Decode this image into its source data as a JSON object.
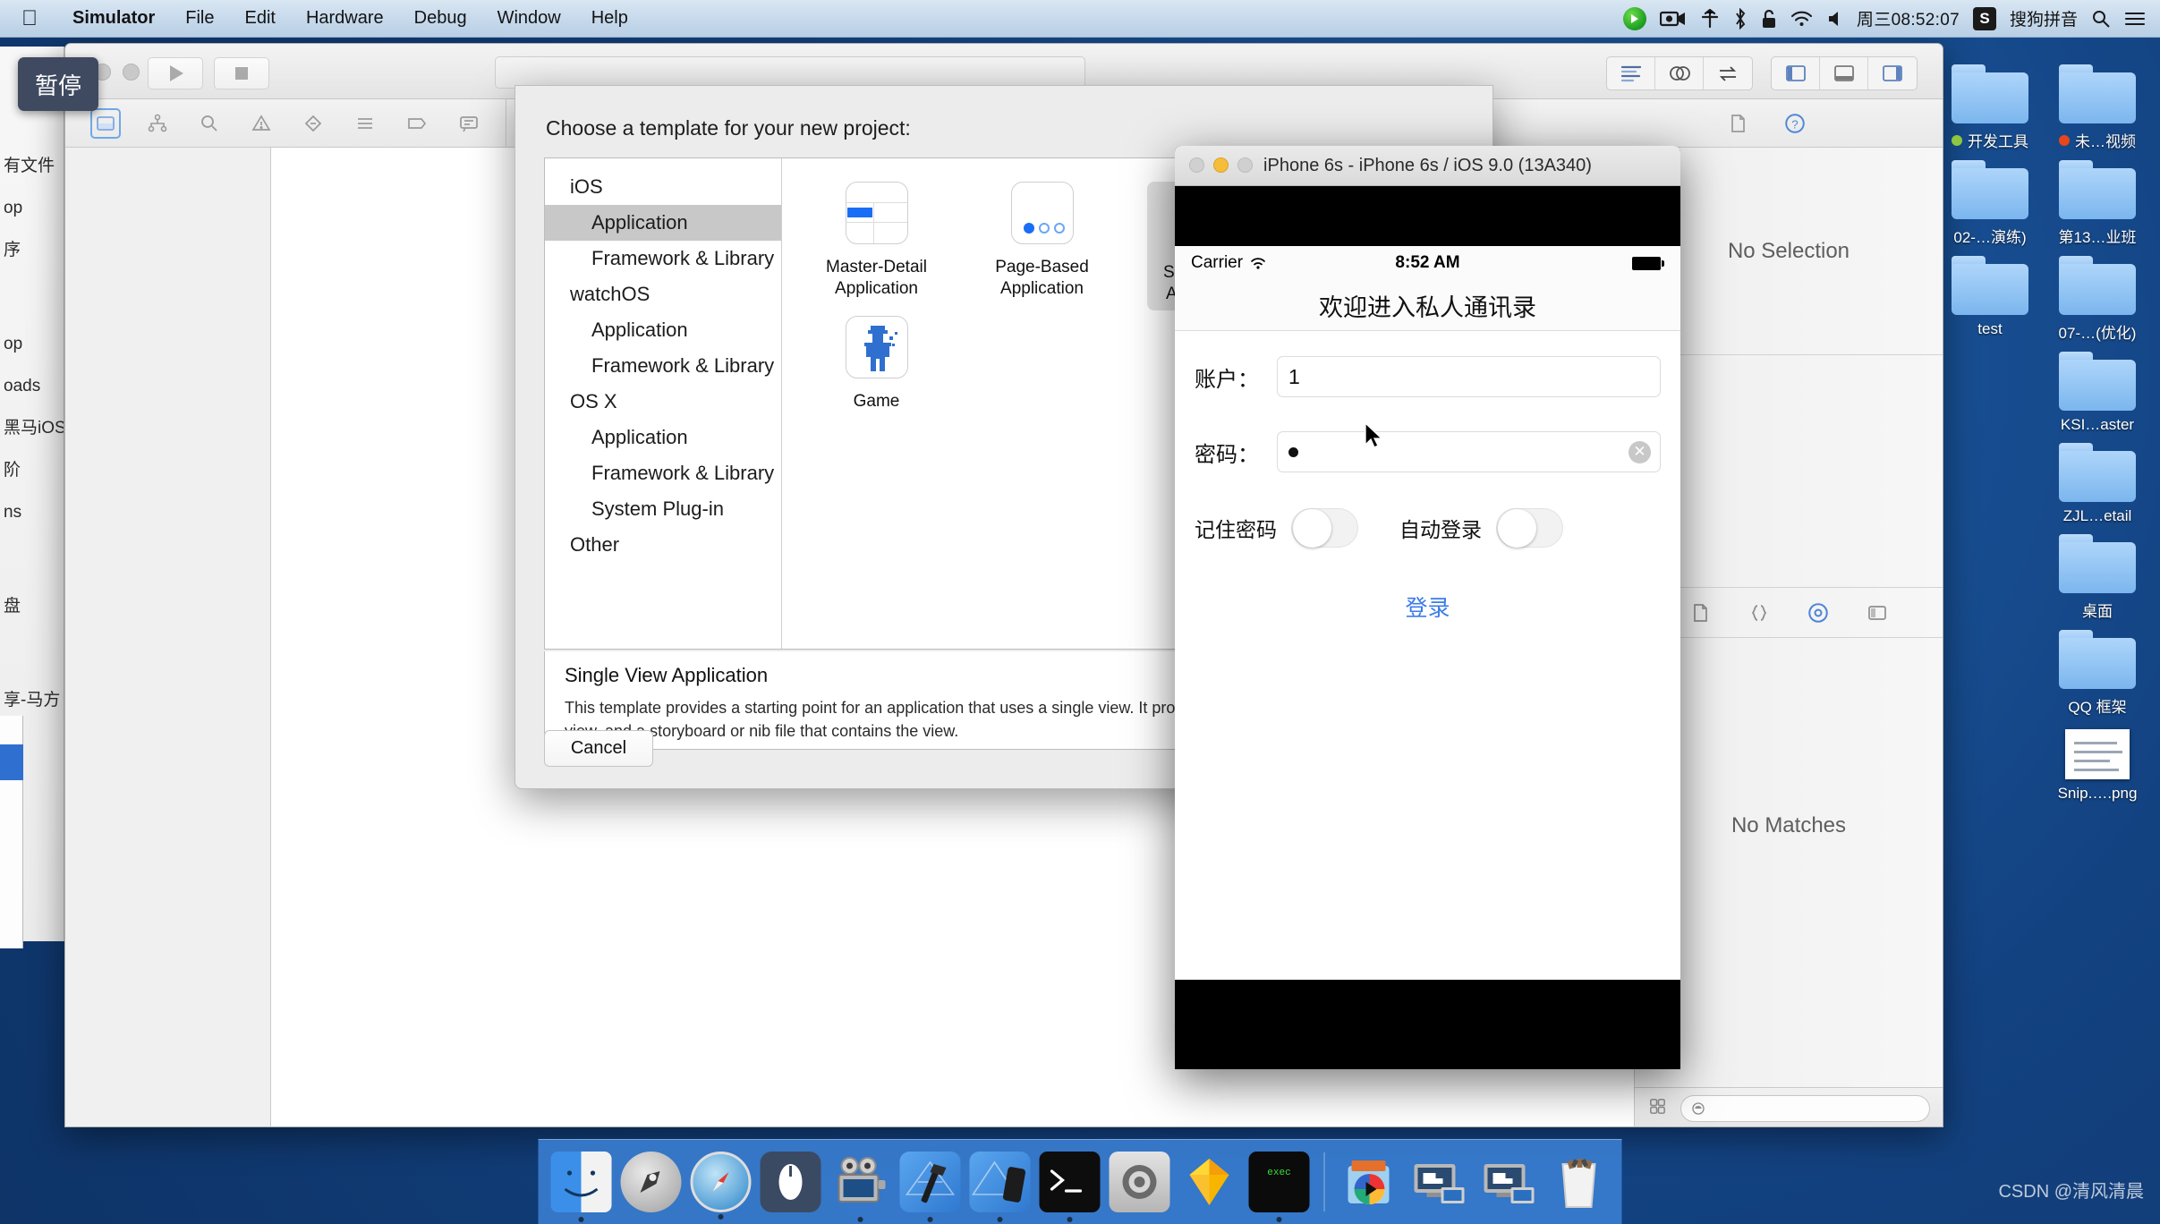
{
  "menubar": {
    "apple_icon": "apple-logo-icon",
    "items": [
      "Simulator",
      "File",
      "Edit",
      "Hardware",
      "Debug",
      "Window",
      "Help"
    ],
    "status_icons": [
      "play-circle-green-icon",
      "screen-record-icon",
      "airplay-icon",
      "bluetooth-icon",
      "lock-icon",
      "wifi-icon",
      "volume-icon"
    ],
    "clock": "周三08:52:07",
    "input_method_badge": "S",
    "input_method_label": "搜狗拼音",
    "search_icon": "search-icon",
    "notification_icon": "notification-center-icon"
  },
  "pause_badge": {
    "label": "暂停"
  },
  "finder_sidebar": {
    "items": [
      "有文件",
      "op",
      "序",
      "",
      "op",
      "oads",
      "黑马iOS",
      "阶",
      "ns",
      "",
      "盘",
      "",
      "享-马方"
    ]
  },
  "xcode": {
    "window_title": "",
    "toolbar": {
      "run_icon": "run-play-icon",
      "stop_icon": "stop-square-icon",
      "crumb_value": "",
      "editor_segment": [
        "standard-editor-icon",
        "assistant-editor-icon",
        "version-editor-icon"
      ],
      "view_segment": [
        "toggle-navigator-icon",
        "toggle-debug-area-icon",
        "toggle-inspector-icon"
      ]
    },
    "navigator_tabs": [
      "project-navigator-icon",
      "symbol-navigator-icon",
      "find-navigator-icon",
      "issue-navigator-icon",
      "test-navigator-icon",
      "debug-navigator-icon",
      "breakpoint-navigator-icon",
      "report-navigator-icon"
    ],
    "inspector_tabs_top": [
      "file-inspector-icon",
      "quick-help-icon"
    ],
    "inspector_tabs_bottom": [
      "file-template-library-icon",
      "code-snippet-library-icon",
      "object-library-icon",
      "media-library-icon"
    ],
    "inspector_no_selection": "No Selection",
    "inspector_no_matches": "No Matches",
    "statusbar": {
      "grid_icon": "library-grid-icon",
      "filter_icon": "filter-icon",
      "filter_value": ""
    }
  },
  "template_sheet": {
    "heading": "Choose a template for your new project:",
    "categories": [
      {
        "label": "iOS",
        "level": 0,
        "selected": false
      },
      {
        "label": "Application",
        "level": 1,
        "selected": true
      },
      {
        "label": "Framework & Library",
        "level": 1,
        "selected": false
      },
      {
        "label": "watchOS",
        "level": 0,
        "selected": false
      },
      {
        "label": "Application",
        "level": 1,
        "selected": false
      },
      {
        "label": "Framework & Library",
        "level": 1,
        "selected": false
      },
      {
        "label": "OS X",
        "level": 0,
        "selected": false
      },
      {
        "label": "Application",
        "level": 1,
        "selected": false
      },
      {
        "label": "Framework & Library",
        "level": 1,
        "selected": false
      },
      {
        "label": "System Plug-in",
        "level": 1,
        "selected": false
      },
      {
        "label": "Other",
        "level": 0,
        "selected": false
      }
    ],
    "templates": [
      {
        "name": "Master-Detail\nApplication",
        "icon": "master-detail-template-icon",
        "active": false
      },
      {
        "name": "Page-Based\nApplication",
        "icon": "page-based-template-icon",
        "active": false
      },
      {
        "name": "Single View\nApplication",
        "icon": "single-view-template-icon",
        "active": true
      },
      {
        "name": "Game",
        "icon": "game-template-icon",
        "active": false
      }
    ],
    "description_title": "Single View Application",
    "description_body": "This template provides a starting point for an application that uses a single view. It provides a view controller to manage the view, and a storyboard or nib file that contains the view.",
    "cancel_label": "Cancel"
  },
  "simulator": {
    "window_title": "iPhone 6s - iPhone 6s / iOS 9.0 (13A340)",
    "ios_status": {
      "carrier": "Carrier",
      "wifi_icon": "wifi-icon",
      "clock": "8:52 AM",
      "battery_icon": "battery-full-icon"
    },
    "nav_title": "欢迎进入私人通讯录",
    "fields": [
      {
        "label": "账户：",
        "value": "1",
        "has_clear": false
      },
      {
        "label": "密码：",
        "value": "●",
        "has_clear": true,
        "clear_icon": "clear-field-icon"
      }
    ],
    "switches": [
      {
        "label": "记住密码",
        "on": false
      },
      {
        "label": "自动登录",
        "on": false
      }
    ],
    "login_label": "登录"
  },
  "desktop_icons": [
    {
      "label": "开发工具",
      "type": "folder",
      "tag": "#8ec63f"
    },
    {
      "label": "未…视频",
      "type": "folder",
      "tag": "#e8461c"
    },
    {
      "label": "02-…演练)",
      "type": "folder",
      "tag": ""
    },
    {
      "label": "第13…业班",
      "type": "folder",
      "tag": ""
    },
    {
      "label": "test",
      "type": "folder",
      "tag": ""
    },
    {
      "label": "07-…(优化)",
      "type": "folder",
      "tag": ""
    },
    {
      "label": "",
      "type": "spacer",
      "tag": ""
    },
    {
      "label": "KSI…aster",
      "type": "folder",
      "tag": ""
    },
    {
      "label": "",
      "type": "spacer",
      "tag": ""
    },
    {
      "label": "ZJL…etail",
      "type": "folder",
      "tag": ""
    },
    {
      "label": "",
      "type": "spacer",
      "tag": ""
    },
    {
      "label": "桌面",
      "type": "folder",
      "tag": ""
    },
    {
      "label": "",
      "type": "spacer",
      "tag": ""
    },
    {
      "label": "QQ 框架",
      "type": "folder",
      "tag": ""
    },
    {
      "label": "",
      "type": "spacer",
      "tag": ""
    },
    {
      "label": "Snip.….png",
      "type": "image",
      "tag": ""
    }
  ],
  "dock": {
    "items": [
      {
        "name": "finder-icon",
        "running": true
      },
      {
        "name": "launchpad-icon",
        "running": false
      },
      {
        "name": "safari-icon",
        "running": true
      },
      {
        "name": "mouse-app-icon",
        "running": false
      },
      {
        "name": "quicktime-player-icon",
        "running": true
      },
      {
        "name": "xcode-icon",
        "running": true
      },
      {
        "name": "simulator-icon",
        "running": true
      },
      {
        "name": "terminal-icon",
        "running": true
      },
      {
        "name": "system-preferences-icon",
        "running": false
      },
      {
        "name": "sketch-icon",
        "running": false
      },
      {
        "name": "exec-app-icon",
        "running": true
      }
    ],
    "items_right": [
      {
        "name": "downloads-stack-icon"
      },
      {
        "name": "screen-sharing-icon"
      },
      {
        "name": "screen-sharing-2-icon"
      },
      {
        "name": "trash-icon"
      }
    ]
  },
  "watermark": "CSDN @清风清晨"
}
